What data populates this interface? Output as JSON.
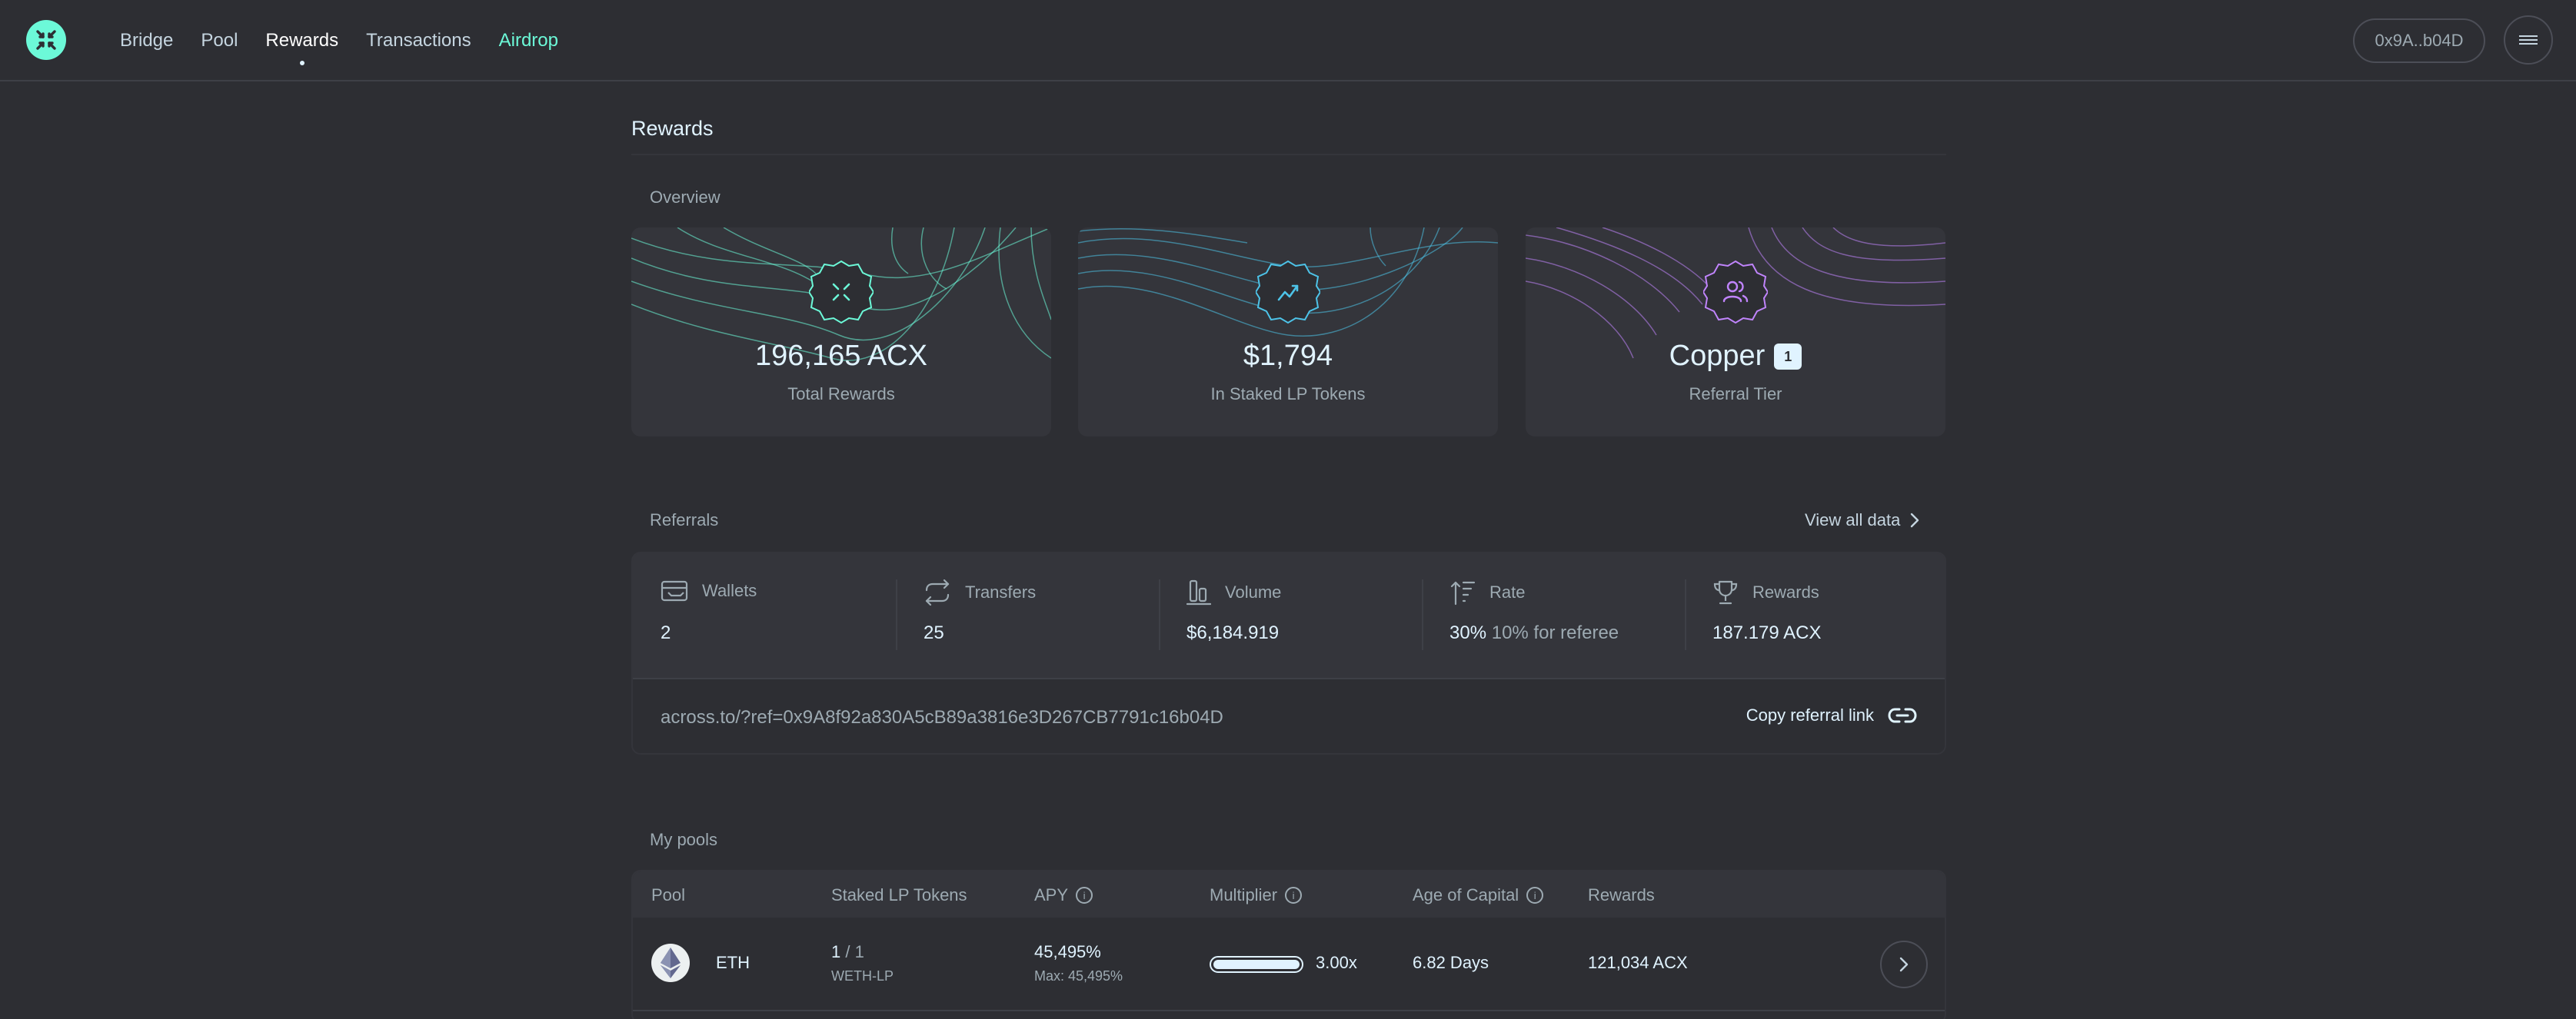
{
  "header": {
    "nav": [
      "Bridge",
      "Pool",
      "Rewards",
      "Transactions",
      "Airdrop"
    ],
    "active_nav": "Rewards",
    "wallet": "0x9A..b04D"
  },
  "page": {
    "title": "Rewards"
  },
  "overview": {
    "label": "Overview",
    "cards": [
      {
        "value": "196,165 ACX",
        "label": "Total Rewards",
        "accent": "#6cf9d8",
        "icon": "across-logo-icon"
      },
      {
        "value": "$1,794",
        "label": "In Staked LP Tokens",
        "accent": "#4dc3e8",
        "icon": "trend-up-icon"
      },
      {
        "value": "Copper",
        "tier": "1",
        "label": "Referral Tier",
        "accent": "#c084fc",
        "icon": "users-icon"
      }
    ]
  },
  "referrals": {
    "label": "Referrals",
    "view_all": "View all data",
    "stats": [
      {
        "label": "Wallets",
        "value": "2",
        "icon": "wallet-icon"
      },
      {
        "label": "Transfers",
        "value": "25",
        "icon": "transfer-icon"
      },
      {
        "label": "Volume",
        "value": "$6,184.919",
        "icon": "volume-icon"
      },
      {
        "label": "Rate",
        "value": "30%",
        "extra": "10% for referee",
        "icon": "rate-icon"
      },
      {
        "label": "Rewards",
        "value": "187.179 ACX",
        "icon": "trophy-icon"
      }
    ],
    "link": "across.to/?ref=0x9A8f92a830A5cB89a3816e3D267CB7791c16b04D",
    "copy_label": "Copy referral link"
  },
  "pools": {
    "label": "My pools",
    "headers": [
      "Pool",
      "Staked LP Tokens",
      "APY",
      "Multiplier",
      "Age of Capital",
      "Rewards"
    ],
    "rows": [
      {
        "pool": "ETH",
        "staked": "1",
        "staked_total": "/ 1",
        "staked_sub": "WETH-LP",
        "apy": "45,495%",
        "apy_sub": "Max: 45,495%",
        "multiplier": "3.00x",
        "multiplier_fill": 1.0,
        "age": "6.82 Days",
        "rewards": "121,034 ACX"
      }
    ]
  }
}
